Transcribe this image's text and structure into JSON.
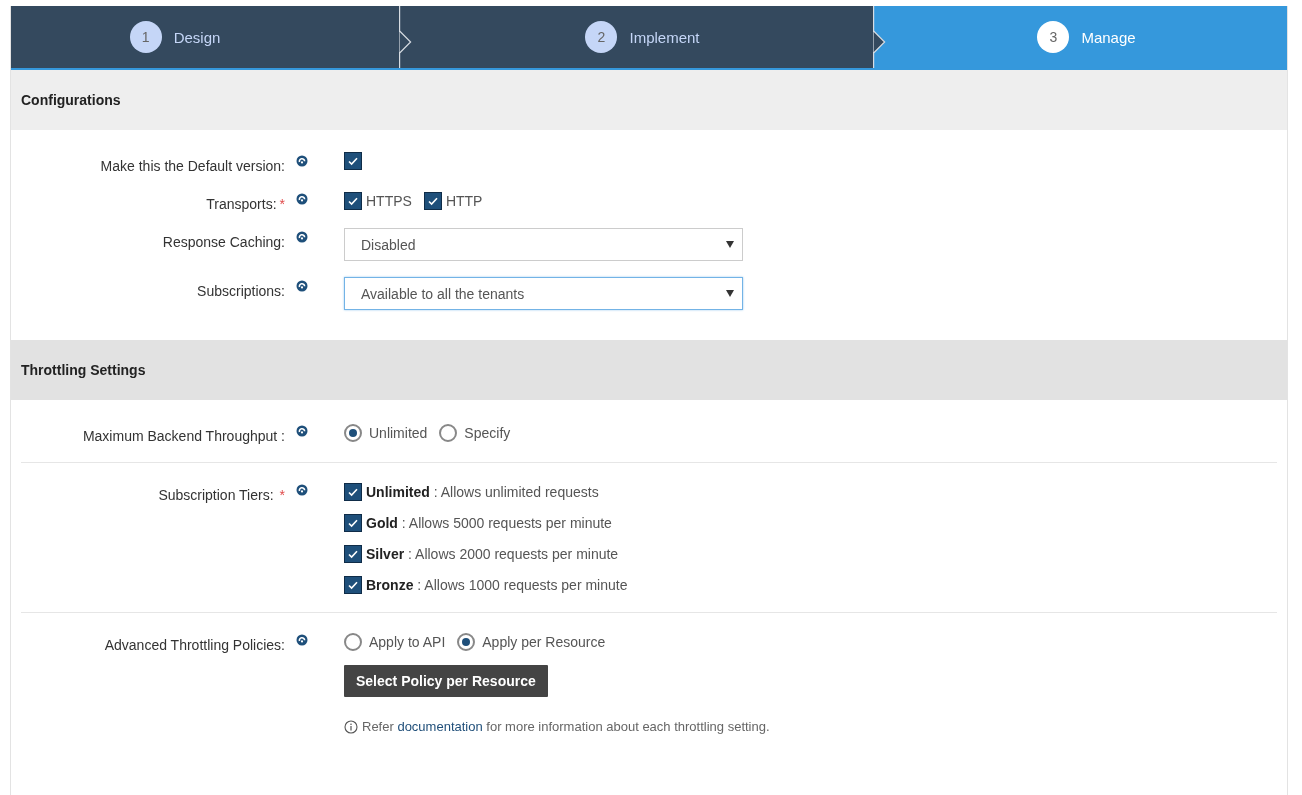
{
  "steps": [
    {
      "number": "1",
      "label": "Design",
      "selected": false
    },
    {
      "number": "2",
      "label": "Implement",
      "selected": false
    },
    {
      "number": "3",
      "label": "Manage",
      "selected": true
    }
  ],
  "sections": [
    {
      "title": "Configurations",
      "fields": [
        {
          "kind": "checkbox",
          "label": "Make this the Default version:",
          "checked": true
        },
        {
          "kind": "checkgroup",
          "label": "Transports:",
          "required_mark": "*",
          "options": [
            {
              "label": "HTTPS",
              "checked": true
            },
            {
              "label": "HTTP",
              "checked": true
            }
          ]
        },
        {
          "kind": "select",
          "label": "Response Caching:",
          "value": "Disabled",
          "focused": false
        },
        {
          "kind": "select",
          "label": "Subscriptions:",
          "value": "Available to all the tenants",
          "focused": true
        }
      ]
    },
    {
      "title": "Throttling Settings",
      "fields": [
        {
          "kind": "radio",
          "label": "Maximum Backend Throughput :",
          "options": [
            {
              "label": "Unlimited",
              "selected": true
            },
            {
              "label": "Specify",
              "selected": false
            }
          ]
        },
        {
          "kind": "tiers",
          "label": "Subscription Tiers:",
          "required_mark": "*",
          "options": [
            {
              "text": "**Unlimited** : Allows unlimited requests",
              "checked": true
            },
            {
              "text": "**Gold** : Allows 5000 requests per minute",
              "checked": true
            },
            {
              "text": "**Silver** : Allows 2000 requests per minute",
              "checked": true
            },
            {
              "text": "**Bronze** : Allows 1000 requests per minute",
              "checked": true
            }
          ]
        },
        {
          "kind": "policies",
          "label": "Advanced Throttling Policies:",
          "options": [
            {
              "label": "Apply to API",
              "selected": false
            },
            {
              "label": "Apply per Resource",
              "selected": true
            }
          ],
          "button": "Select Policy per Resource",
          "note": {
            "before": "Refer",
            "link": "documentation",
            "after": "for more information about each throttling setting."
          }
        }
      ]
    }
  ]
}
